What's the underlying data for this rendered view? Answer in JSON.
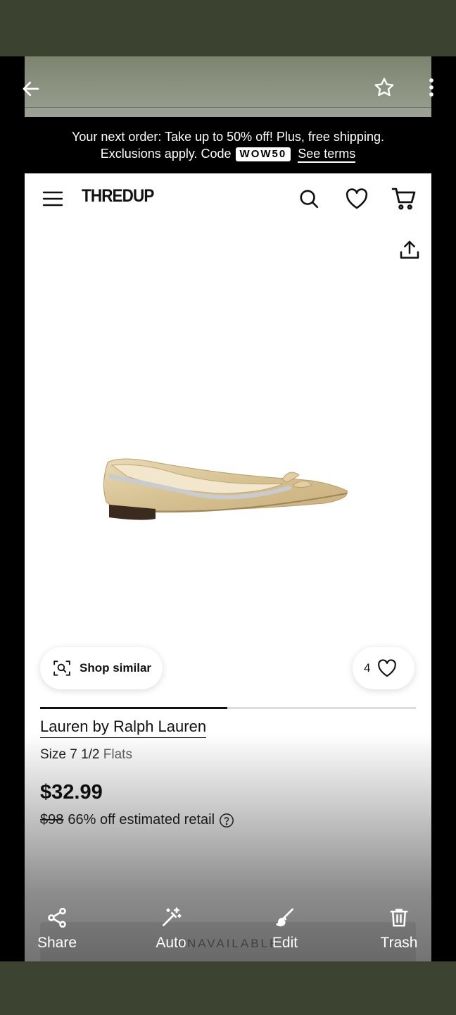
{
  "promo": {
    "line1": "Your next order: Take up to 50% off! Plus, free shipping.",
    "line2_prefix": "Exclusions apply. Code",
    "code": "WOW50",
    "terms_link": "See terms"
  },
  "site": {
    "logo": "THREDUP"
  },
  "product": {
    "shop_similar_label": "Shop similar",
    "favorite_count": "4",
    "brand": "Lauren by Ralph Lauren",
    "size_label": "Size 7 1/2",
    "category": "Flats",
    "price": "$32.99",
    "original_price": "$98",
    "discount_text": "66% off estimated retail",
    "status_button": "UNAVAILABLE"
  },
  "toolbar": {
    "share": "Share",
    "auto": "Auto",
    "edit": "Edit",
    "trash": "Trash"
  },
  "icons": {
    "back": "arrow-left-icon",
    "star": "star-outline-icon",
    "more": "more-vertical-icon",
    "menu": "hamburger-icon",
    "search": "search-icon",
    "heart": "heart-outline-icon",
    "cart": "cart-icon",
    "upload": "share-upload-icon"
  },
  "colors": {
    "frame": "#3c4431",
    "promo_bg": "#000000",
    "accent": "#111111"
  }
}
